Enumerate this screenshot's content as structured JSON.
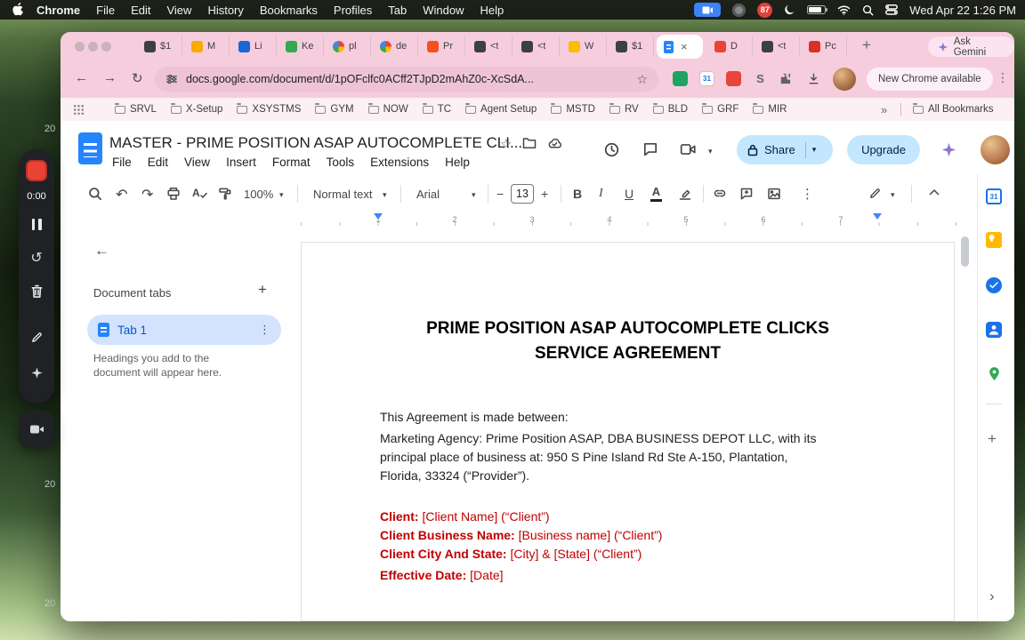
{
  "colors": {
    "accent_blue": "#0b57d0",
    "selection_bg": "#d3e3fd",
    "share_button_bg": "#c2e7ff",
    "chrome_theme_pink": "#f6cddd",
    "doc_red": "#c00000"
  },
  "icons": {
    "back": "←",
    "forward": "→",
    "reload": "↻",
    "star": "☆",
    "kebab": "⋮",
    "plus": "+",
    "close": "×",
    "chevron_down": "▾",
    "chevron_right": "›",
    "overflow": "»",
    "undo": "↶",
    "redo": "↷",
    "minus": "−",
    "restart": "↺",
    "bold": "B",
    "italic": "I",
    "underline": "U",
    "text_color": "A"
  },
  "desktop": {
    "side_numbers": [
      "20",
      "20",
      "20"
    ]
  },
  "menubar": {
    "app": "Chrome",
    "items": [
      "File",
      "Edit",
      "View",
      "History",
      "Bookmarks",
      "Profiles",
      "Tab",
      "Window",
      "Help"
    ],
    "badge": "87",
    "clock": "Wed Apr 22 1:26 PM"
  },
  "tabstrip": {
    "tabs": [
      {
        "label": "$1",
        "color": "#3c4043"
      },
      {
        "label": "M",
        "color": "#f9ab00"
      },
      {
        "label": "Li",
        "color": "#1967d2"
      },
      {
        "label": "Ke",
        "color": "#34a853"
      },
      {
        "label": "pl",
        "color": "#ffffff"
      },
      {
        "label": "de",
        "color": "#ffffff"
      },
      {
        "label": "Pr",
        "color": "#f4511e"
      },
      {
        "label": "<t",
        "color": "#3c4043"
      },
      {
        "label": "<t",
        "color": "#3c4043"
      },
      {
        "label": "W",
        "color": "#fbbc04"
      },
      {
        "label": "$1",
        "color": "#3c4043"
      }
    ],
    "tabs_after": [
      {
        "label": "D",
        "color": "#ea4335"
      },
      {
        "label": "<t",
        "color": "#3c4043"
      },
      {
        "label": "Pc",
        "color": "#d93025"
      }
    ],
    "gemini": "Ask Gemini"
  },
  "nav": {
    "url": "docs.google.com/document/d/1pOFclfc0ACff2TJpD2mAhZ0c-XcSdA...",
    "ext_calendar_badge": "31",
    "ext_letter": "S",
    "new_chrome": "New Chrome available"
  },
  "bookmarks": {
    "items": [
      "SRVL",
      "X-Setup",
      "XSYSTMS",
      "GYM",
      "NOW",
      "TC",
      "Agent Setup",
      "MSTD",
      "RV",
      "BLD",
      "GRF",
      "MIR"
    ],
    "all": "All Bookmarks"
  },
  "docs": {
    "title": "MASTER - PRIME POSITION ASAP AUTOCOMPLETE CLI...",
    "menus": [
      "File",
      "Edit",
      "View",
      "Insert",
      "Format",
      "Tools",
      "Extensions",
      "Help"
    ],
    "share": "Share",
    "upgrade": "Upgrade",
    "toolbar": {
      "zoom": "100%",
      "style": "Normal text",
      "font": "Arial",
      "size": "13"
    },
    "ruler": [
      "1",
      "2",
      "3",
      "4",
      "5",
      "6",
      "7"
    ],
    "panel": {
      "header": "Document tabs",
      "tab": "Tab 1",
      "hint": "Headings you add to the document will appear here."
    },
    "sidepanel": {
      "calendar_day": "31"
    },
    "page": {
      "title1": "PRIME POSITION ASAP AUTOCOMPLETE CLICKS",
      "title2": "SERVICE AGREEMENT",
      "intro": "This Agreement is made between:",
      "body": [
        "Marketing Agency: Prime Position ASAP, DBA BUSINESS DEPOT LLC, with its",
        "principal place of business at: 950 S Pine Island Rd Ste A-150, Plantation,",
        "Florida, 33324 (“Provider”)."
      ],
      "red": [
        {
          "label": "Client:",
          "rest": " [Client Name] (“Client”)"
        },
        {
          "label": "Client Business Name:",
          "rest": " [Business name] (“Client”)"
        },
        {
          "label": "Client City And State:",
          "rest": " [City] & [State] (“Client”)"
        },
        {
          "label": "Effective Date:",
          "rest": " [Date]"
        }
      ]
    }
  },
  "recorder": {
    "time": "0:00"
  }
}
